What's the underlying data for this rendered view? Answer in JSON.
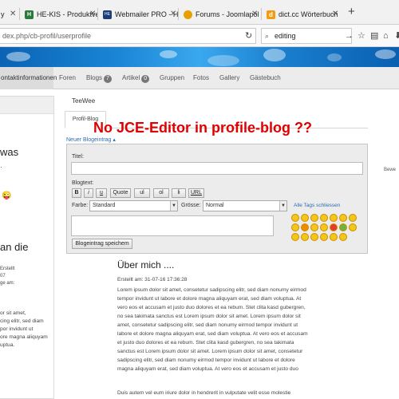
{
  "tabs": [
    {
      "label": "y",
      "fav": "#888"
    },
    {
      "label": "HE-KIS - Produktverwaltu...",
      "fav": "#2b7a3c",
      "favtext": "H"
    },
    {
      "label": "Webmailer PRO - Host Eur...",
      "fav": "#1c3e78",
      "favtext": "HE"
    },
    {
      "label": "Forums - Joomlapolis For...",
      "fav": "#e8a000"
    },
    {
      "label": "dict.cc Wörterbuch :: editi...",
      "fav": "#f39c12",
      "favtext": "d"
    }
  ],
  "new_tab": "+",
  "url": "dex.php/cb-profil/userprofile",
  "search_value": "editing",
  "profile_tabs": [
    {
      "label": "ontaktinformationen"
    },
    {
      "label": "Foren"
    },
    {
      "label": "Blogs",
      "badge": "7"
    },
    {
      "label": "Artikel",
      "badge": "0"
    },
    {
      "label": "Gruppen"
    },
    {
      "label": "Fotos"
    },
    {
      "label": "Gallery"
    },
    {
      "label": "Gästebuch"
    }
  ],
  "sidebar": {
    "was": "was",
    "an_die": "an die",
    "erstellt": "Erstellt",
    "num": "07",
    "ge_am": "ge am:",
    "lines": [
      "or sit amet,",
      "cing elitr, sed diam",
      "por invidunt ut",
      "ore magna aliquyam",
      "uptua."
    ]
  },
  "main": {
    "username": "TeeWee",
    "tab_label": "Profil-Blog",
    "headline": "No JCE-Editor in profile-blog ??",
    "new_entry": "Neuer Blogeintrag ▴",
    "form": {
      "title_label": "Titel:",
      "blogtext_label": "Blogtext:",
      "buttons": [
        "B",
        "i",
        "u",
        "Quote",
        "ul",
        "ol",
        "li",
        "URL"
      ],
      "color_label": "Farbe:",
      "color_value": "Standard",
      "size_label": "Grösse:",
      "size_value": "Normal",
      "close_tags": "Alle Tags schliessen",
      "save_button": "Blogeintrag speichem"
    },
    "about_heading": "Über mich ....",
    "created": "Erstellt am: 31-07-16 17:36:28",
    "para1": "Lorem ipsum dolor sit amet, consetetur sadipscing elitr, sed diam nonumy eirmod tempor invidunt ut labore et dolore magna aliquyam erat, sed diam voluptua. At vero eos et accusam et justo duo dolores et ea rebum. Stet clita kasd gubergren, no sea takimata sanctus est Lorem ipsum dolor sit amet. Lorem ipsum dolor sit amet, consetetur sadipscing elitr, sed diam nonumy eirmod tempor invidunt ut labore et dolore magna aliquyam erat, sed diam voluptua. At vero eos et accusam et justo duo dolores et ea rebum. Stet clita kasd gubergren, no sea takimata sanctus est Lorem ipsum dolor sit amet. Lorem ipsum dolor sit amet, consetetur sadipscing elitr, sed diam nonumy eirmod tempor invidunt ut labore et dolore magna aliquyam erat, sed diam voluptua. At vero eos et accusam et justo duo dolores et ea rebum. Stet clita kasd gubergren, no sea takimata sanctus est Lorem ipsum dolor sit amet.",
    "para2": "Duis autem vel eum iriure dolor in hendrerit in vulputate velit esse molestie",
    "right_edge": "Bewe"
  },
  "colors": {
    "headline": "#e00000",
    "link": "#2a6db5",
    "banner": "#1a86d6"
  }
}
